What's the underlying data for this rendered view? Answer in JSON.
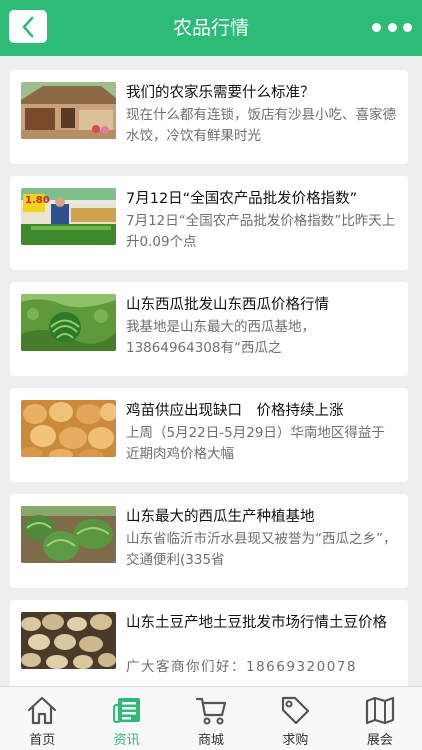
{
  "header": {
    "title": "农品行情"
  },
  "colors": {
    "brand": "#2dbb78"
  },
  "articles": [
    {
      "title": "我们的农家乐需要什么标准？",
      "desc": "现在什么都有连锁，饭店有沙县小吃、喜家德水饺，冷饮有鲜果时光",
      "image": "farmhouse"
    },
    {
      "title": "7月12日“全国农产品批发价格指数”",
      "desc": "7月12日“全国农产品批发价格指数”比昨天上升0.09个点",
      "image": "market-stall",
      "badge": "1.80"
    },
    {
      "title": "山东西瓜批发山东西瓜价格行情",
      "desc": "我基地是山东最大的西瓜基地，13864964308有“西瓜之",
      "image": "watermelon-field"
    },
    {
      "title": "鸡苗供应出现缺口　价格持续上涨",
      "desc": "上周（5月22日-5月29日）华南地区得益于近期肉鸡价格大幅",
      "image": "chicks"
    },
    {
      "title": "山东最大的西瓜生产种植基地",
      "desc": "山东省临沂市沂水县现又被誉为“西瓜之乡”，交通便利(335省",
      "image": "watermelons"
    },
    {
      "title": "山东土豆产地土豆批发市场行情土豆价格",
      "desc": "广大客商你们好：18669320078",
      "image": "potatoes"
    }
  ],
  "tabs": [
    {
      "label": "首页",
      "icon": "home-icon"
    },
    {
      "label": "资讯",
      "icon": "news-icon",
      "active": true
    },
    {
      "label": "商城",
      "icon": "cart-icon"
    },
    {
      "label": "求购",
      "icon": "tag-icon"
    },
    {
      "label": "展会",
      "icon": "map-icon"
    }
  ]
}
